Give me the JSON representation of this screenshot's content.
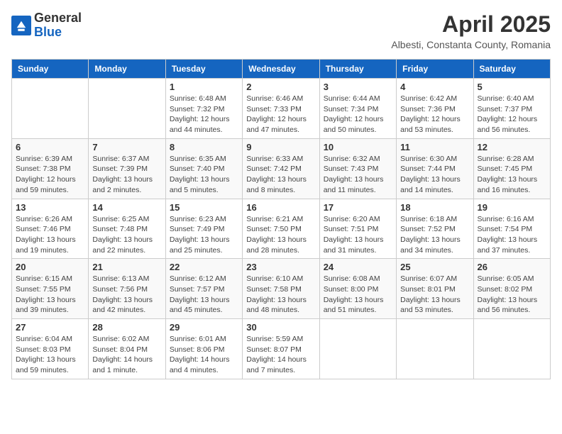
{
  "header": {
    "logo_general": "General",
    "logo_blue": "Blue",
    "month_title": "April 2025",
    "location": "Albesti, Constanta County, Romania"
  },
  "weekdays": [
    "Sunday",
    "Monday",
    "Tuesday",
    "Wednesday",
    "Thursday",
    "Friday",
    "Saturday"
  ],
  "weeks": [
    [
      {
        "day": "",
        "info": ""
      },
      {
        "day": "",
        "info": ""
      },
      {
        "day": "1",
        "info": "Sunrise: 6:48 AM\nSunset: 7:32 PM\nDaylight: 12 hours\nand 44 minutes."
      },
      {
        "day": "2",
        "info": "Sunrise: 6:46 AM\nSunset: 7:33 PM\nDaylight: 12 hours\nand 47 minutes."
      },
      {
        "day": "3",
        "info": "Sunrise: 6:44 AM\nSunset: 7:34 PM\nDaylight: 12 hours\nand 50 minutes."
      },
      {
        "day": "4",
        "info": "Sunrise: 6:42 AM\nSunset: 7:36 PM\nDaylight: 12 hours\nand 53 minutes."
      },
      {
        "day": "5",
        "info": "Sunrise: 6:40 AM\nSunset: 7:37 PM\nDaylight: 12 hours\nand 56 minutes."
      }
    ],
    [
      {
        "day": "6",
        "info": "Sunrise: 6:39 AM\nSunset: 7:38 PM\nDaylight: 12 hours\nand 59 minutes."
      },
      {
        "day": "7",
        "info": "Sunrise: 6:37 AM\nSunset: 7:39 PM\nDaylight: 13 hours\nand 2 minutes."
      },
      {
        "day": "8",
        "info": "Sunrise: 6:35 AM\nSunset: 7:40 PM\nDaylight: 13 hours\nand 5 minutes."
      },
      {
        "day": "9",
        "info": "Sunrise: 6:33 AM\nSunset: 7:42 PM\nDaylight: 13 hours\nand 8 minutes."
      },
      {
        "day": "10",
        "info": "Sunrise: 6:32 AM\nSunset: 7:43 PM\nDaylight: 13 hours\nand 11 minutes."
      },
      {
        "day": "11",
        "info": "Sunrise: 6:30 AM\nSunset: 7:44 PM\nDaylight: 13 hours\nand 14 minutes."
      },
      {
        "day": "12",
        "info": "Sunrise: 6:28 AM\nSunset: 7:45 PM\nDaylight: 13 hours\nand 16 minutes."
      }
    ],
    [
      {
        "day": "13",
        "info": "Sunrise: 6:26 AM\nSunset: 7:46 PM\nDaylight: 13 hours\nand 19 minutes."
      },
      {
        "day": "14",
        "info": "Sunrise: 6:25 AM\nSunset: 7:48 PM\nDaylight: 13 hours\nand 22 minutes."
      },
      {
        "day": "15",
        "info": "Sunrise: 6:23 AM\nSunset: 7:49 PM\nDaylight: 13 hours\nand 25 minutes."
      },
      {
        "day": "16",
        "info": "Sunrise: 6:21 AM\nSunset: 7:50 PM\nDaylight: 13 hours\nand 28 minutes."
      },
      {
        "day": "17",
        "info": "Sunrise: 6:20 AM\nSunset: 7:51 PM\nDaylight: 13 hours\nand 31 minutes."
      },
      {
        "day": "18",
        "info": "Sunrise: 6:18 AM\nSunset: 7:52 PM\nDaylight: 13 hours\nand 34 minutes."
      },
      {
        "day": "19",
        "info": "Sunrise: 6:16 AM\nSunset: 7:54 PM\nDaylight: 13 hours\nand 37 minutes."
      }
    ],
    [
      {
        "day": "20",
        "info": "Sunrise: 6:15 AM\nSunset: 7:55 PM\nDaylight: 13 hours\nand 39 minutes."
      },
      {
        "day": "21",
        "info": "Sunrise: 6:13 AM\nSunset: 7:56 PM\nDaylight: 13 hours\nand 42 minutes."
      },
      {
        "day": "22",
        "info": "Sunrise: 6:12 AM\nSunset: 7:57 PM\nDaylight: 13 hours\nand 45 minutes."
      },
      {
        "day": "23",
        "info": "Sunrise: 6:10 AM\nSunset: 7:58 PM\nDaylight: 13 hours\nand 48 minutes."
      },
      {
        "day": "24",
        "info": "Sunrise: 6:08 AM\nSunset: 8:00 PM\nDaylight: 13 hours\nand 51 minutes."
      },
      {
        "day": "25",
        "info": "Sunrise: 6:07 AM\nSunset: 8:01 PM\nDaylight: 13 hours\nand 53 minutes."
      },
      {
        "day": "26",
        "info": "Sunrise: 6:05 AM\nSunset: 8:02 PM\nDaylight: 13 hours\nand 56 minutes."
      }
    ],
    [
      {
        "day": "27",
        "info": "Sunrise: 6:04 AM\nSunset: 8:03 PM\nDaylight: 13 hours\nand 59 minutes."
      },
      {
        "day": "28",
        "info": "Sunrise: 6:02 AM\nSunset: 8:04 PM\nDaylight: 14 hours\nand 1 minute."
      },
      {
        "day": "29",
        "info": "Sunrise: 6:01 AM\nSunset: 8:06 PM\nDaylight: 14 hours\nand 4 minutes."
      },
      {
        "day": "30",
        "info": "Sunrise: 5:59 AM\nSunset: 8:07 PM\nDaylight: 14 hours\nand 7 minutes."
      },
      {
        "day": "",
        "info": ""
      },
      {
        "day": "",
        "info": ""
      },
      {
        "day": "",
        "info": ""
      }
    ]
  ]
}
